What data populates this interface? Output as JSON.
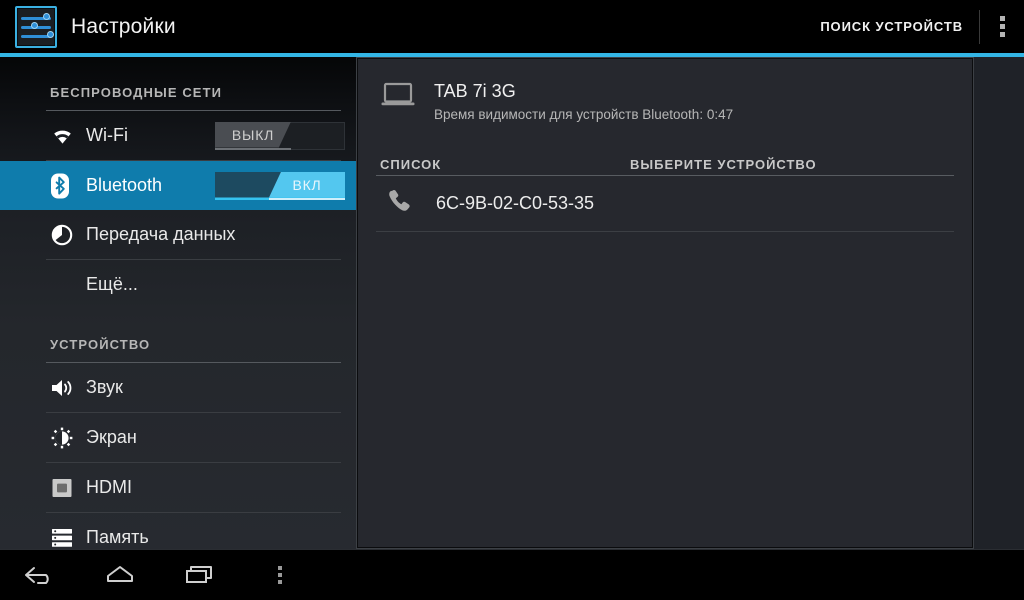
{
  "app": {
    "title": "Настройки",
    "icon": "settings-sliders-icon",
    "accent_color": "#33b5e5"
  },
  "actionbar": {
    "search_devices_label": "ПОИСК УСТРОЙСТВ",
    "overflow_icon": "overflow-menu-icon"
  },
  "sidebar": {
    "sections": [
      {
        "header": "БЕСПРОВОДНЫЕ СЕТИ",
        "items": [
          {
            "label": "Wi-Fi",
            "icon": "wifi-icon",
            "switch": {
              "state": "off",
              "label": "ВЫКЛ"
            },
            "selected": false
          },
          {
            "label": "Bluetooth",
            "icon": "bluetooth-icon",
            "switch": {
              "state": "on",
              "label": "ВКЛ"
            },
            "selected": true
          },
          {
            "label": "Передача данных",
            "icon": "data-usage-icon",
            "selected": false
          },
          {
            "label": "Ещё...",
            "icon": "none",
            "selected": false
          }
        ]
      },
      {
        "header": "УСТРОЙСТВО",
        "items": [
          {
            "label": "Звук",
            "icon": "sound-icon",
            "selected": false
          },
          {
            "label": "Экран",
            "icon": "display-brightness-icon",
            "selected": false
          },
          {
            "label": "HDMI",
            "icon": "hdmi-icon",
            "selected": false
          },
          {
            "label": "Память",
            "icon": "storage-icon",
            "selected": false
          }
        ]
      }
    ],
    "highlight_color": "#0f7cac"
  },
  "content": {
    "device": {
      "icon": "laptop-icon",
      "name": "TAB 7i 3G",
      "visibility_text": "Время видимости для устройств Bluetooth: 0:47"
    },
    "list_header": {
      "left": "СПИСОК",
      "right": "ВЫБЕРИТЕ УСТРОЙСТВО"
    },
    "devices": [
      {
        "icon": "phone-icon",
        "label": "6C-9B-02-C0-53-35"
      }
    ]
  },
  "navbar": {
    "buttons": [
      {
        "name": "back",
        "icon": "back-arrow-icon"
      },
      {
        "name": "home",
        "icon": "home-icon"
      },
      {
        "name": "recents",
        "icon": "recents-icon"
      },
      {
        "name": "menu",
        "icon": "menu-dots-icon"
      }
    ]
  }
}
